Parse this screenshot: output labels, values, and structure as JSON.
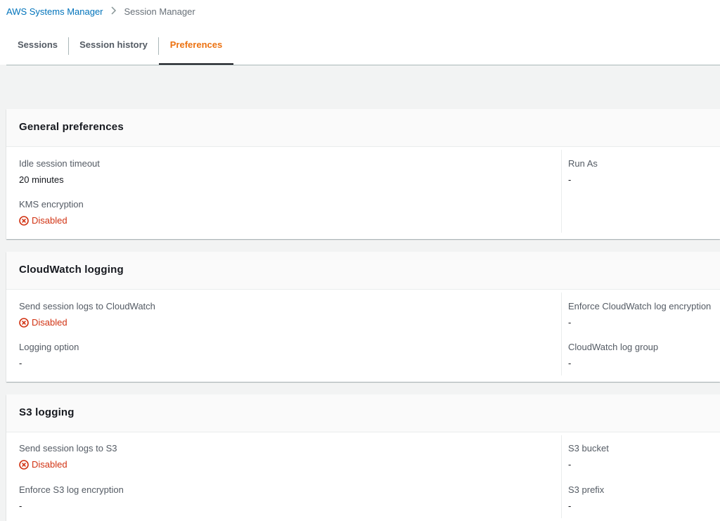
{
  "breadcrumb": {
    "parent": "AWS Systems Manager",
    "current": "Session Manager"
  },
  "tabs": [
    {
      "label": "Sessions"
    },
    {
      "label": "Session history"
    },
    {
      "label": "Preferences"
    }
  ],
  "general": {
    "title": "General preferences",
    "idle_label": "Idle session timeout",
    "idle_value": "20 minutes",
    "kms_label": "KMS encryption",
    "kms_value": "Disabled",
    "runas_label": "Run As",
    "runas_value": "-"
  },
  "cloudwatch": {
    "title": "CloudWatch logging",
    "send_label": "Send session logs to CloudWatch",
    "send_value": "Disabled",
    "option_label": "Logging option",
    "option_value": "-",
    "enforce_label": "Enforce CloudWatch log encryption",
    "enforce_value": "-",
    "group_label": "CloudWatch log group",
    "group_value": "-"
  },
  "s3": {
    "title": "S3 logging",
    "send_label": "Send session logs to S3",
    "send_value": "Disabled",
    "enforce_label": "Enforce S3 log encryption",
    "enforce_value": "-",
    "bucket_label": "S3 bucket",
    "bucket_value": "-",
    "prefix_label": "S3 prefix",
    "prefix_value": "-"
  },
  "colors": {
    "link": "#0073bb",
    "active_tab": "#ec7211",
    "error": "#d13212"
  },
  "icons": {
    "status": "error-circle-x-icon",
    "separator": "chevron-right-icon"
  }
}
